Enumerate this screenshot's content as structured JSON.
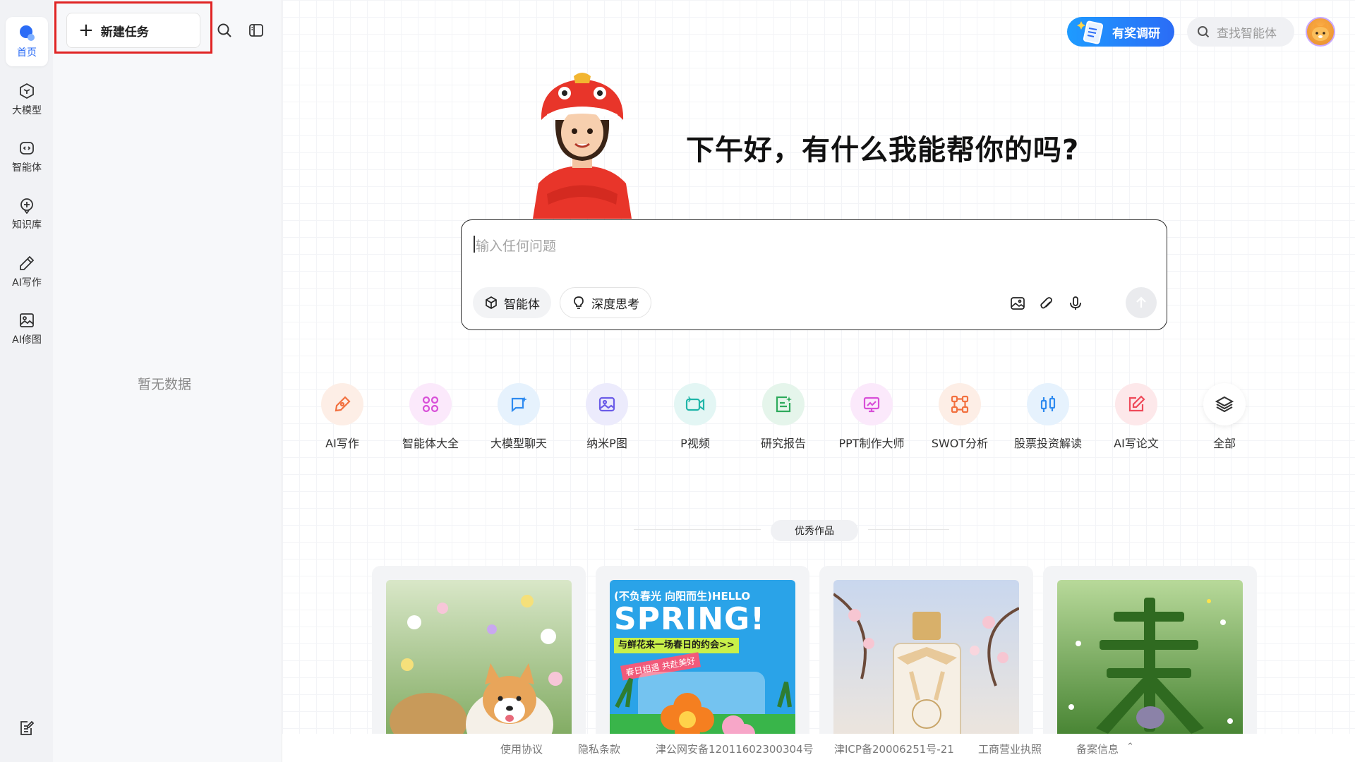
{
  "rail": {
    "items": [
      {
        "label": "首页",
        "icon": "home-icon",
        "active": true
      },
      {
        "label": "大模型",
        "icon": "model-icon"
      },
      {
        "label": "智能体",
        "icon": "agent-icon"
      },
      {
        "label": "知识库",
        "icon": "knowledge-icon"
      },
      {
        "label": "AI写作",
        "icon": "pen-icon"
      },
      {
        "label": "AI修图",
        "icon": "image-icon"
      }
    ],
    "bottom_icon": "notes-icon"
  },
  "panel": {
    "new_task_label": "新建任务",
    "empty_text": "暂无数据"
  },
  "header": {
    "survey_label": "有奖调研",
    "search_placeholder": "查找智能体"
  },
  "greeting": "下午好，有什么我能帮你的吗?",
  "input": {
    "placeholder": "输入任何问题",
    "chip_agent": "智能体",
    "chip_deep": "深度思考"
  },
  "shortcuts": [
    {
      "label": "AI写作",
      "icon": "pen-icon",
      "color": "#f2703f",
      "bg": "#fdeee6"
    },
    {
      "label": "智能体大全",
      "icon": "grid-icon",
      "color": "#d84fd8",
      "bg": "#fbe9fb"
    },
    {
      "label": "大模型聊天",
      "icon": "chat-icon",
      "color": "#2e8bf0",
      "bg": "#e6f2fd"
    },
    {
      "label": "纳米P图",
      "icon": "photo-icon",
      "color": "#6b5ce8",
      "bg": "#ecebfc"
    },
    {
      "label": "P视频",
      "icon": "video-icon",
      "color": "#1fb5a8",
      "bg": "#e3f6f4"
    },
    {
      "label": "研究报告",
      "icon": "report-icon",
      "color": "#2eaa5c",
      "bg": "#e5f5eb"
    },
    {
      "label": "PPT制作大师",
      "icon": "ppt-icon",
      "color": "#d84fd8",
      "bg": "#fbe9fb"
    },
    {
      "label": "SWOT分析",
      "icon": "swot-icon",
      "color": "#f2703f",
      "bg": "#fdeee6"
    },
    {
      "label": "股票投资解读",
      "icon": "stock-icon",
      "color": "#2e8bf0",
      "bg": "#e6f2fd"
    },
    {
      "label": "AI写论文",
      "icon": "paper-icon",
      "color": "#ef4a5a",
      "bg": "#fde8ea"
    },
    {
      "label": "全部",
      "icon": "layers-icon",
      "color": "#333333",
      "bg": "#ffffff"
    }
  ],
  "showcase": {
    "title": "优秀作品",
    "cards": [
      {
        "name": "puppy-flowers"
      },
      {
        "name": "hello-spring",
        "line1": "(不负春光 向阳而生)HELLO",
        "line2": "SPRING!",
        "line3": "与鲜花来一场春日的约会>>",
        "line4": "春日相遇 共赴美好"
      },
      {
        "name": "perfume"
      },
      {
        "name": "grass-spring"
      }
    ]
  },
  "footer": {
    "links": [
      "使用协议",
      "隐私条款",
      "津公网安备12011602300304号",
      "津ICP备20006251号-21",
      "工商营业执照",
      "备案信息"
    ]
  }
}
